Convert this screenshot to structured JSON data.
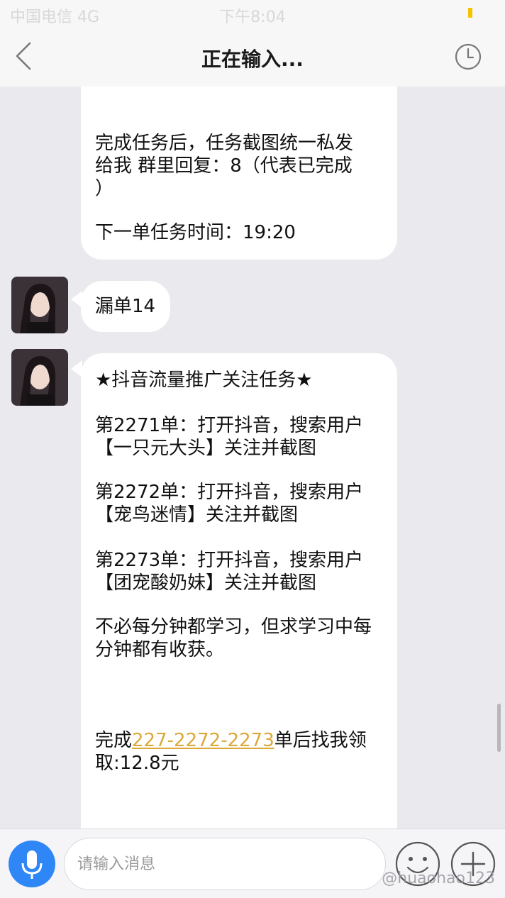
{
  "status_bar": {
    "carrier": "中国电信  4G",
    "time": "下午8:04"
  },
  "nav": {
    "title": "正在输入..."
  },
  "messages": {
    "m1": {
      "line1": "完成任务后，任务截图统一私发",
      "line2": "给我   群里回复：8（代表已完成",
      "line3": "）",
      "line4": "下一单任务时间：19:20"
    },
    "m2": {
      "text": "漏单14"
    },
    "m3": {
      "heading": "★抖音流量推广关注任务★",
      "order1_line1": "第2271单：打开抖音，搜索用户",
      "order1_line2": "【一只元大头】关注并截图",
      "order2_line1": "第2272单：打开抖音，搜索用户",
      "order2_line2": "【宠鸟迷情】关注并截图",
      "order3_line1": "第2273单：打开抖音，搜索用户",
      "order3_line2": "【团宠酸奶妹】关注并截图",
      "quote_line1": "不必每分钟都学习，但求学习中每",
      "quote_line2": "分钟都有收获。",
      "reward_prefix": "完成",
      "reward_link": "227-2272-2273",
      "reward_suffix": "单后找我领",
      "reward_line2": "取:12.8元"
    }
  },
  "input_bar": {
    "placeholder": "请输入消息"
  },
  "watermark": "@huaohao123",
  "colors": {
    "background": "#e9e9ee",
    "bubble": "#ffffff",
    "mic": "#2f86f6",
    "link": "#dba93a"
  }
}
